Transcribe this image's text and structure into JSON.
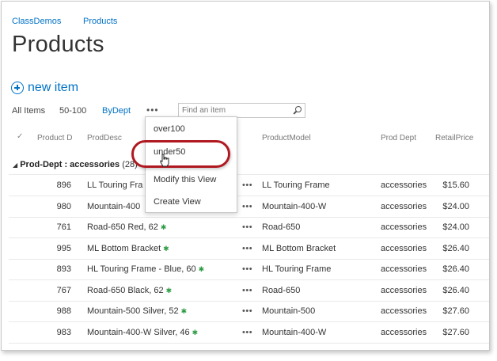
{
  "breadcrumb": {
    "site": "ClassDemos",
    "current": "Products"
  },
  "page_title": "Products",
  "new_item_label": "new item",
  "views": {
    "tabs": [
      "All Items",
      "50-100",
      "ByDept"
    ],
    "active": "ByDept",
    "more": "•••"
  },
  "search": {
    "placeholder": "Find an item"
  },
  "columns": [
    "Product D",
    "ProdDesc",
    "ProductModel",
    "Prod Dept",
    "RetailPrice"
  ],
  "group": {
    "label": "Prod-Dept : accessories",
    "count": "(28)"
  },
  "rows": [
    {
      "id": "896",
      "desc": "LL Touring Fra",
      "new": false,
      "model": "LL Touring Frame",
      "dept": "accessories",
      "price": "$15.60"
    },
    {
      "id": "980",
      "desc": "Mountain-400",
      "new": false,
      "model": "Mountain-400-W",
      "dept": "accessories",
      "price": "$24.00"
    },
    {
      "id": "761",
      "desc": "Road-650 Red, 62",
      "new": true,
      "model": "Road-650",
      "dept": "accessories",
      "price": "$24.00"
    },
    {
      "id": "995",
      "desc": "ML Bottom Bracket",
      "new": true,
      "model": "ML Bottom Bracket",
      "dept": "accessories",
      "price": "$26.40"
    },
    {
      "id": "893",
      "desc": "HL Touring Frame - Blue, 60",
      "new": true,
      "model": "HL Touring Frame",
      "dept": "accessories",
      "price": "$26.40"
    },
    {
      "id": "767",
      "desc": "Road-650 Black, 62",
      "new": true,
      "model": "Road-650",
      "dept": "accessories",
      "price": "$26.40"
    },
    {
      "id": "988",
      "desc": "Mountain-500 Silver, 52",
      "new": true,
      "model": "Mountain-500",
      "dept": "accessories",
      "price": "$27.60"
    },
    {
      "id": "983",
      "desc": "Mountain-400-W Silver, 46",
      "new": true,
      "model": "Mountain-400-W",
      "dept": "accessories",
      "price": "$27.60"
    }
  ],
  "row_menu": "•••",
  "new_badge": "✱",
  "view_menu": [
    "over100",
    "under50",
    "Modify this View",
    "Create View"
  ],
  "colors": {
    "accent": "#0072c6",
    "highlight": "#b01820",
    "new_badge": "#2e9c45"
  }
}
